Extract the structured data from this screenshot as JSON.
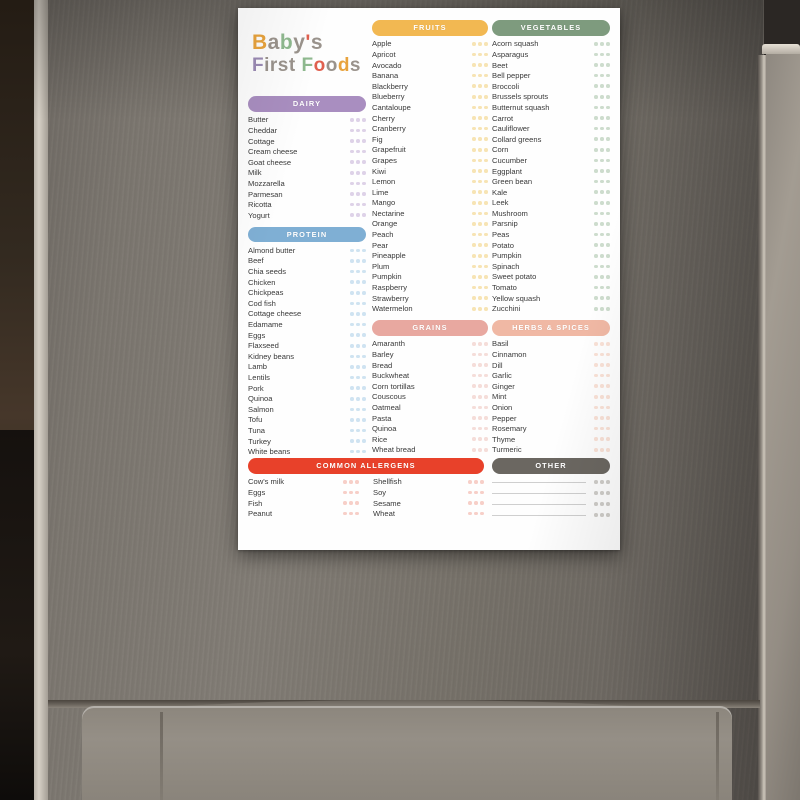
{
  "poster": {
    "title_line1": "Baby's",
    "title_line2": "First Foods",
    "title_colors_line1": [
      "#e8a33d",
      "#9a938c",
      "#8fb98f",
      "#9a938c",
      "#e0604f",
      "#9a938c"
    ],
    "title_colors_line2": [
      "#9b8bb4",
      "#9a938c",
      "#9a938c",
      "#9a938c",
      "#9a938c",
      "#8fb98f",
      "#e0604f",
      "#9a938c",
      "#e8a33d",
      "#9a938c",
      "#9a938c"
    ],
    "dots_per_row": 3
  },
  "sections": [
    {
      "id": "dairy",
      "label": "DAIRY",
      "color": "#a98ec0",
      "dot_color": "#ded2e8",
      "column": "left",
      "items": [
        "Butter",
        "Cheddar",
        "Cottage",
        "Cream cheese",
        "Goat cheese",
        "Milk",
        "Mozzarella",
        "Parmesan",
        "Ricotta",
        "Yogurt"
      ]
    },
    {
      "id": "protein",
      "label": "PROTEIN",
      "color": "#7fafd4",
      "dot_color": "#cfe3f1",
      "column": "left",
      "items": [
        "Almond butter",
        "Beef",
        "Chia seeds",
        "Chicken",
        "Chickpeas",
        "Cod fish",
        "Cottage cheese",
        "Edamame",
        "Eggs",
        "Flaxseed",
        "Kidney beans",
        "Lamb",
        "Lentils",
        "Pork",
        "Quinoa",
        "Salmon",
        "Tofu",
        "Tuna",
        "Turkey",
        "White beans"
      ]
    },
    {
      "id": "fruits",
      "label": "FRUITS",
      "color": "#f2b852",
      "dot_color": "#f7e4b4",
      "column": "mid",
      "items": [
        "Apple",
        "Apricot",
        "Avocado",
        "Banana",
        "Blackberry",
        "Blueberry",
        "Cantaloupe",
        "Cherry",
        "Cranberry",
        "Fig",
        "Grapefruit",
        "Grapes",
        "Kiwi",
        "Lemon",
        "Lime",
        "Mango",
        "Nectarine",
        "Orange",
        "Peach",
        "Pear",
        "Pineapple",
        "Plum",
        "Pumpkin",
        "Raspberry",
        "Strawberry",
        "Watermelon"
      ]
    },
    {
      "id": "grains",
      "label": "GRAINS",
      "color": "#e8a8a0",
      "dot_color": "#f5ddd9",
      "column": "mid",
      "items": [
        "Amaranth",
        "Barley",
        "Bread",
        "Buckwheat",
        "Corn tortillas",
        "Couscous",
        "Oatmeal",
        "Pasta",
        "Quinoa",
        "Rice",
        "Wheat bread"
      ]
    },
    {
      "id": "vegetables",
      "label": "VEGETABLES",
      "color": "#7e9b7e",
      "dot_color": "#cddccd",
      "column": "right",
      "items": [
        "Acorn squash",
        "Asparagus",
        "Beet",
        "Bell pepper",
        "Broccoli",
        "Brussels sprouts",
        "Butternut squash",
        "Carrot",
        "Cauliflower",
        "Collard greens",
        "Corn",
        "Cucumber",
        "Eggplant",
        "Green bean",
        "Kale",
        "Leek",
        "Mushroom",
        "Parsnip",
        "Peas",
        "Potato",
        "Pumpkin",
        "Spinach",
        "Sweet potato",
        "Tomato",
        "Yellow squash",
        "Zucchini"
      ]
    },
    {
      "id": "herbs-spices",
      "label": "HERBS & SPICES",
      "color": "#f0b8a4",
      "dot_color": "#f9e1d6",
      "column": "right",
      "items": [
        "Basil",
        "Cinnamon",
        "Dill",
        "Garlic",
        "Ginger",
        "Mint",
        "Onion",
        "Pepper",
        "Rosemary",
        "Thyme",
        "Turmeric"
      ]
    }
  ],
  "allergens": {
    "id": "common-allergens",
    "label": "COMMON ALLERGENS",
    "color": "#e8412a",
    "dot_color": "#f7cfc8",
    "left_items": [
      "Cow's milk",
      "Eggs",
      "Fish",
      "Peanut"
    ],
    "right_items": [
      "Shellfish",
      "Soy",
      "Sesame",
      "Wheat"
    ]
  },
  "other": {
    "id": "other",
    "label": "OTHER",
    "color": "#6b6761",
    "dot_color": "#cfcdc9",
    "blank_rows": 4
  }
}
